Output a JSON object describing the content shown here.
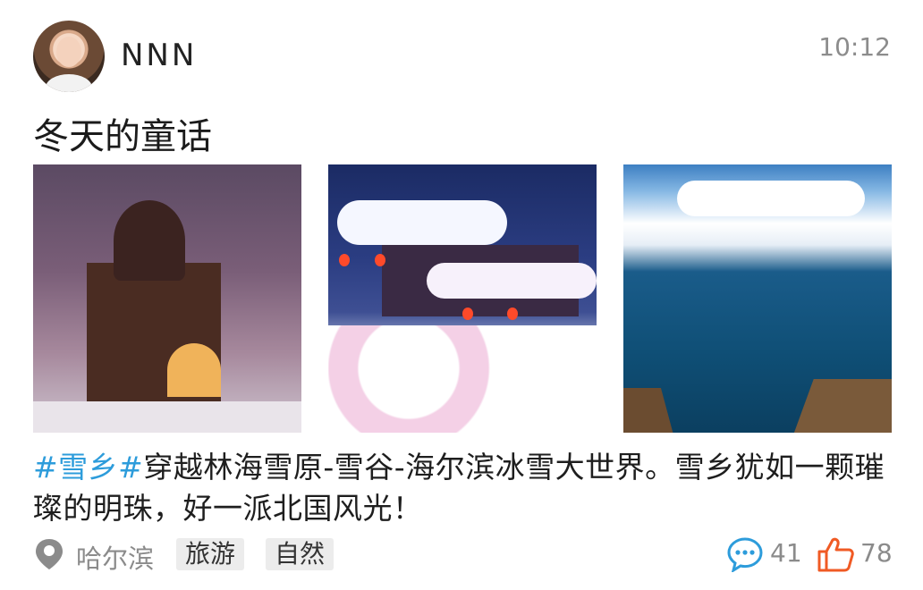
{
  "post": {
    "username": "NNN",
    "time": "10:12",
    "title": "冬天的童话",
    "description": {
      "hashtag": "#雪乡#",
      "text": "穿越林海雪原-雪谷-海尔滨冰雪大世界。雪乡犹如一颗璀璨的明珠，好一派北国风光！"
    },
    "location": "哈尔滨",
    "tags": [
      "旅游",
      "自然"
    ],
    "comments": "41",
    "likes": "78"
  },
  "colors": {
    "hashtag": "#2d9cdb",
    "like_icon": "#f05a24",
    "comment_icon": "#2d9cdb",
    "location_icon": "#8b8b8b"
  },
  "icons": {
    "location": "map-pin-icon",
    "comment": "speech-bubble-icon",
    "like": "thumbs-up-icon"
  }
}
